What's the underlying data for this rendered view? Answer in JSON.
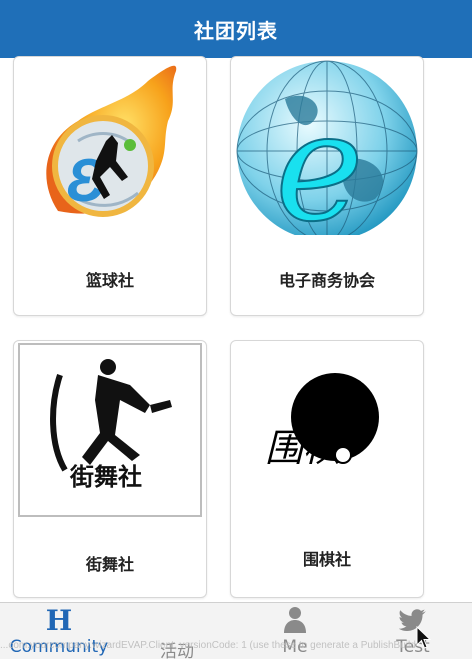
{
  "header": {
    "title": "社团列表"
  },
  "clubs": [
    {
      "name": "篮球社",
      "image_icon": "basketball-logo-icon"
    },
    {
      "name": "电子商务协会",
      "image_icon": "ecommerce-globe-icon"
    },
    {
      "name": "街舞社",
      "image_icon": "street-dance-logo-icon",
      "image_text": "街舞社"
    },
    {
      "name": "围棋社",
      "image_icon": "go-club-logo-icon",
      "image_text": "围棋"
    }
  ],
  "tabs": [
    {
      "label": "Community",
      "icon": "H",
      "active": true
    },
    {
      "label": "活动",
      "icon": "activity-icon",
      "active": false
    },
    {
      "label": "Me",
      "icon": "person-icon",
      "active": false
    },
    {
      "label": "Test",
      "icon": "twitter-bird-icon",
      "active": false
    }
  ],
  "footer_note": "...com.yourcompany.wizardEVAP.Client, versionCode: 1 (use these to generate a PublishBuild"
}
